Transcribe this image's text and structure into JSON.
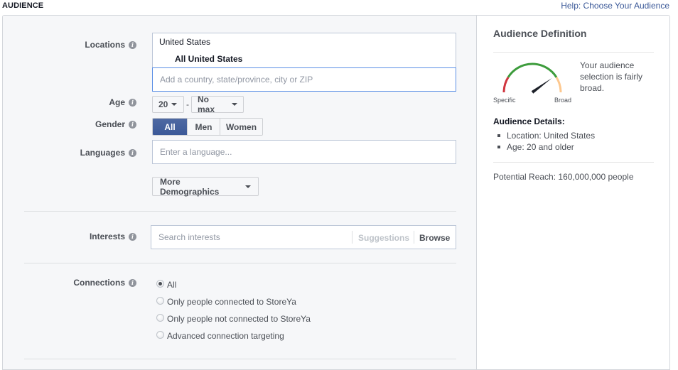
{
  "header": {
    "section_title": "AUDIENCE",
    "help_link": "Help: Choose Your Audience"
  },
  "form": {
    "locations": {
      "label": "Locations",
      "selected_country": "United States",
      "selected_scope": "All United States",
      "placeholder": "Add a country, state/province, city or ZIP"
    },
    "age": {
      "label": "Age",
      "min": "20",
      "max": "No max",
      "separator": "-"
    },
    "gender": {
      "label": "Gender",
      "options": [
        "All",
        "Men",
        "Women"
      ],
      "selected": "All"
    },
    "languages": {
      "label": "Languages",
      "placeholder": "Enter a language..."
    },
    "more_demographics": "More Demographics",
    "interests": {
      "label": "Interests",
      "placeholder": "Search interests",
      "suggestions": "Suggestions",
      "browse": "Browse"
    },
    "connections": {
      "label": "Connections",
      "options": [
        "All",
        "Only people connected to StoreYa",
        "Only people not connected to StoreYa",
        "Advanced connection targeting"
      ],
      "selected": "All"
    }
  },
  "audience_definition": {
    "title": "Audience Definition",
    "gauge": {
      "left_label": "Specific",
      "right_label": "Broad",
      "level_fraction": 0.8,
      "colors": {
        "specific": "#d0353f",
        "good": "#3d9c3c",
        "broad": "#fdc88f",
        "needle": "#1d2129"
      }
    },
    "summary": "Your audience selection is fairly broad.",
    "details_title": "Audience Details:",
    "details": [
      "Location: United States",
      "Age: 20 and older"
    ],
    "potential_reach": "Potential Reach: 160,000,000 people"
  },
  "colors": {
    "accent": "#3b5998",
    "link": "#3b5998",
    "focus_border": "#5b8fe6"
  }
}
